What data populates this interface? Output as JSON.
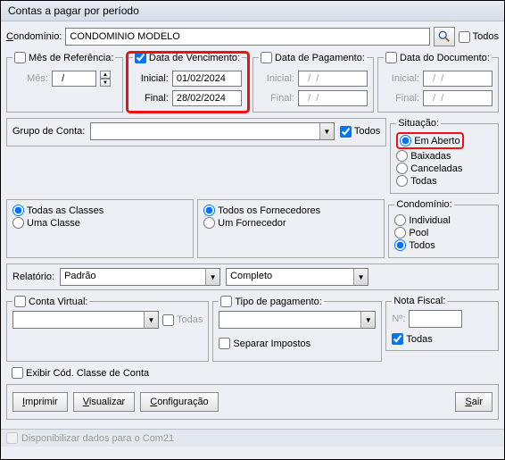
{
  "window": {
    "title": "Contas a pagar por período"
  },
  "condominio": {
    "label": "Condomínio:",
    "value": "CONDOMINIO MODELO",
    "todos": "Todos"
  },
  "mesref": {
    "legend": "Mês de Referência:",
    "label": "Mês:",
    "value": "  /"
  },
  "datavenc": {
    "legend": "Data de Vencimento:",
    "checked": true,
    "inicial_lbl": "Inicial:",
    "final_lbl": "Final:",
    "inicial": "01/02/2024",
    "final": "28/02/2024"
  },
  "datapag": {
    "legend": "Data de Pagamento:",
    "inicial_lbl": "Inicial:",
    "final_lbl": "Final:",
    "inicial": "  /  /",
    "final": "  /  /"
  },
  "datadoc": {
    "legend": "Data do Documento:",
    "inicial_lbl": "Inicial:",
    "final_lbl": "Final:",
    "inicial": "  /  /",
    "final": "  /  /"
  },
  "grupoconta": {
    "label": "Grupo de Conta:",
    "value": "",
    "todos": "Todos"
  },
  "situacao": {
    "legend": "Situação:",
    "options": [
      "Em Aberto",
      "Baixadas",
      "Canceladas",
      "Todas"
    ],
    "selected": 0
  },
  "classes": {
    "todas": "Todas as Classes",
    "uma": "Uma Classe"
  },
  "fornec": {
    "todos": "Todos os Fornecedores",
    "um": "Um Fornecedor"
  },
  "cond2": {
    "legend": "Condomínio:",
    "options": [
      "Individual",
      "Pool",
      "Todos"
    ],
    "selected": 2
  },
  "relatorio": {
    "label": "Relatório:",
    "value": "Padrão",
    "completo": "Completo"
  },
  "contavirtual": {
    "legend": "Conta Virtual:",
    "todas": "Todas"
  },
  "tipopag": {
    "legend": "Tipo de pagamento:"
  },
  "nota": {
    "legend": "Nota Fiscal:",
    "num_lbl": "Nº:",
    "todas": "Todas"
  },
  "separar": "Separar Impostos",
  "exibircod": "Exibir Cód. Classe de Conta",
  "buttons": {
    "imprimir": "Imprimir",
    "visualizar": "Visualizar",
    "config": "Configuração",
    "sair": "Sair"
  },
  "footer": "Disponibilizar dados para o Com21"
}
